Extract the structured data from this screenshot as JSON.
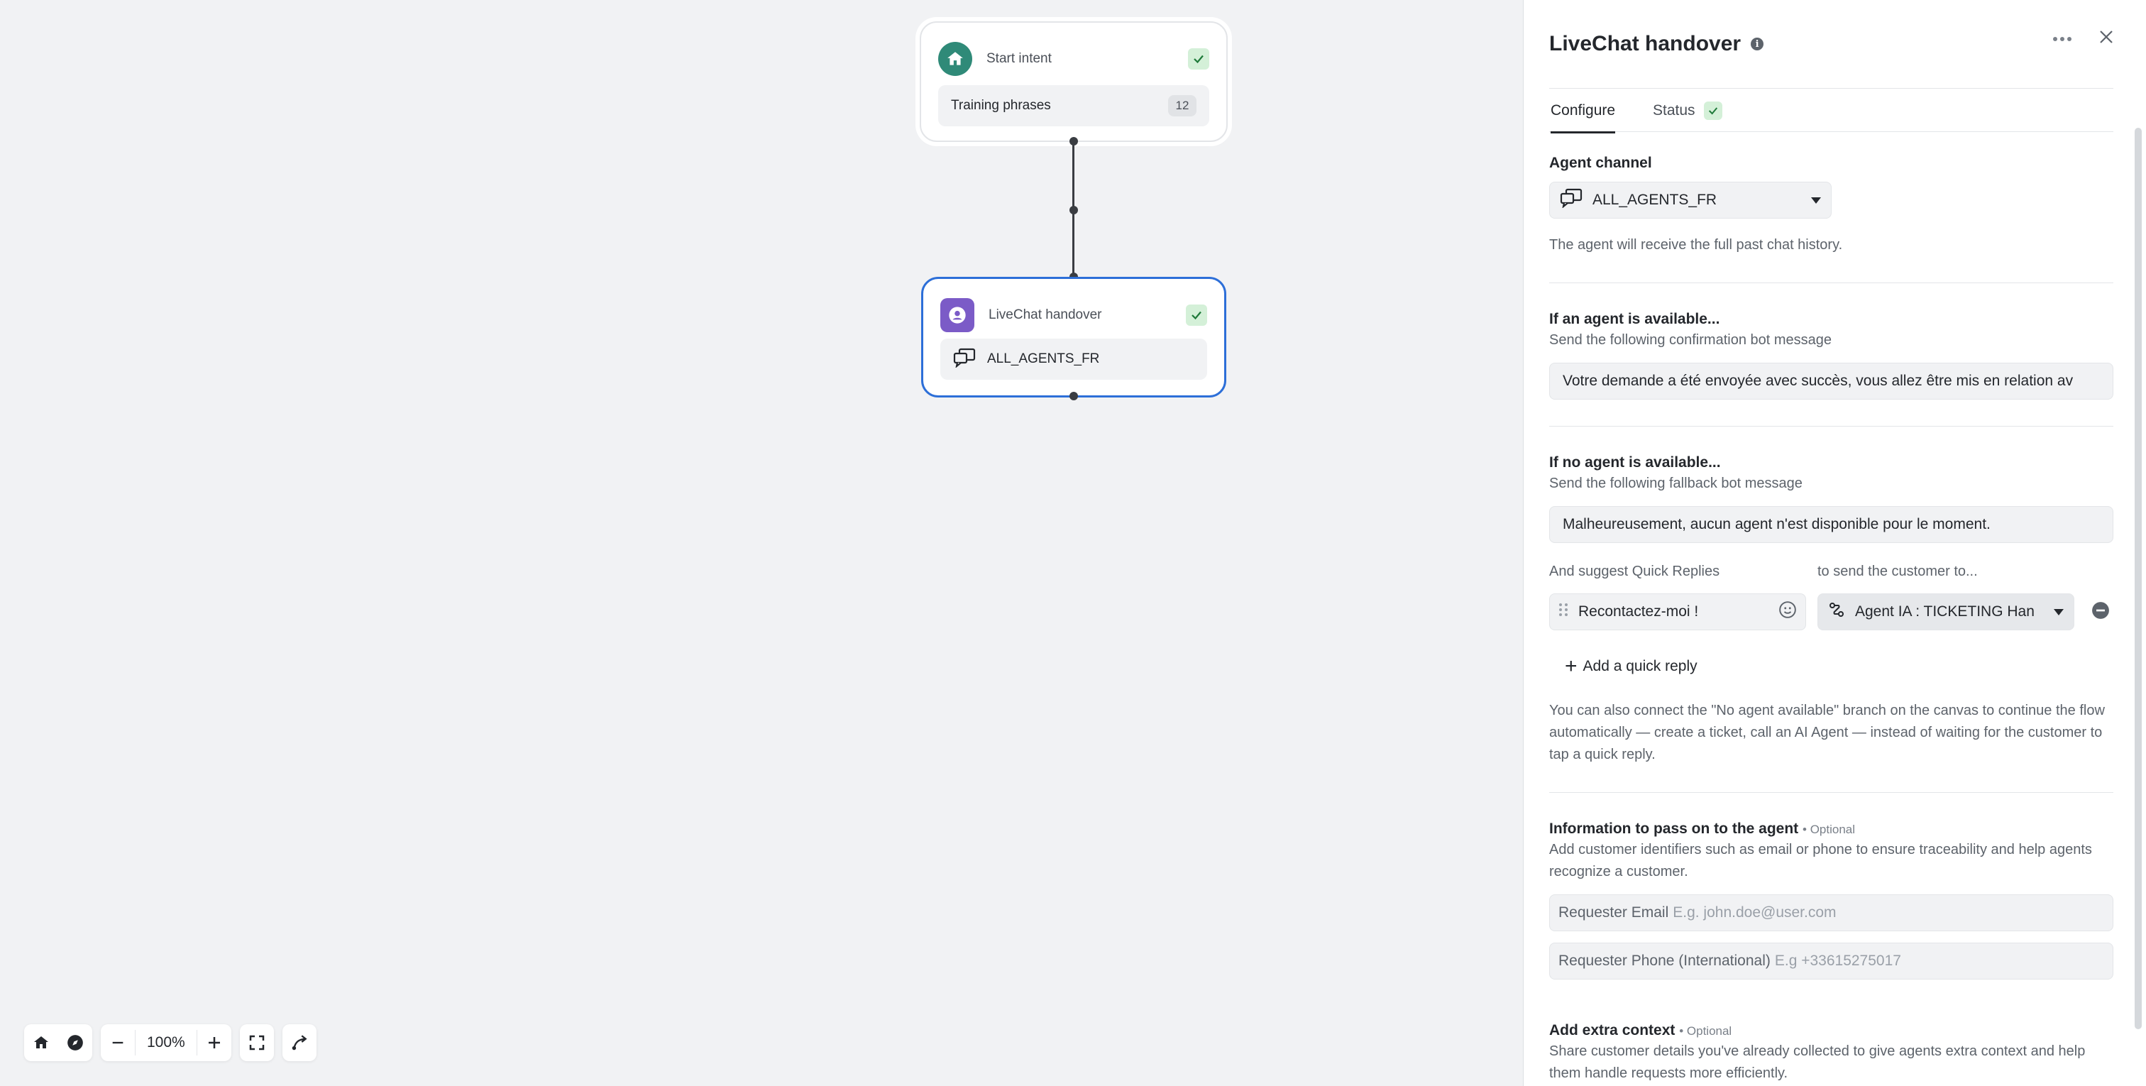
{
  "canvas": {
    "start_node": {
      "title": "Start intent",
      "body_label": "Training phrases",
      "count": "12"
    },
    "handover_node": {
      "title": "LiveChat handover",
      "body_label": "ALL_AGENTS_FR"
    },
    "toolbar": {
      "zoom": "100%"
    }
  },
  "panel": {
    "title": "LiveChat handover",
    "tabs": [
      {
        "label": "Configure"
      },
      {
        "label": "Status"
      }
    ],
    "agent_channel": {
      "label": "Agent channel",
      "value": "ALL_AGENTS_FR",
      "helper": "The agent will receive the full past chat history."
    },
    "agent_available": {
      "label": "If an agent is available...",
      "sub": "Send the following confirmation bot message",
      "message": "Votre demande a été envoyée avec succès, vous allez être mis en relation av"
    },
    "no_agent": {
      "label": "If no agent is available...",
      "sub": "Send the following fallback bot message",
      "message": "Malheureusement, aucun agent n'est disponible pour le moment.",
      "quick_replies_label": "And suggest Quick Replies",
      "send_to_label": "to send the customer to...",
      "quick_reply": "Recontactez-moi !",
      "destination": "Agent IA : TICKETING Han",
      "add_quick_reply": "Add a quick reply",
      "helper": "You can also connect the \"No agent available\" branch on the canvas to continue the flow automatically — create a ticket, call an AI Agent — instead of waiting for the customer to tap a quick reply."
    },
    "info_to_agent": {
      "label": "Information to pass on to the agent",
      "optional": "• Optional",
      "helper": "Add customer identifiers such as email or phone to ensure traceability and help agents recognize a customer.",
      "email_label": "Requester Email",
      "email_placeholder": "E.g. john.doe@user.com",
      "phone_label": "Requester Phone (International)",
      "phone_placeholder": "E.g +33615275017"
    },
    "extra_context": {
      "label": "Add extra context",
      "optional": "• Optional",
      "helper": "Share customer details you've already collected to give agents extra context and help them handle requests more efficiently."
    }
  }
}
